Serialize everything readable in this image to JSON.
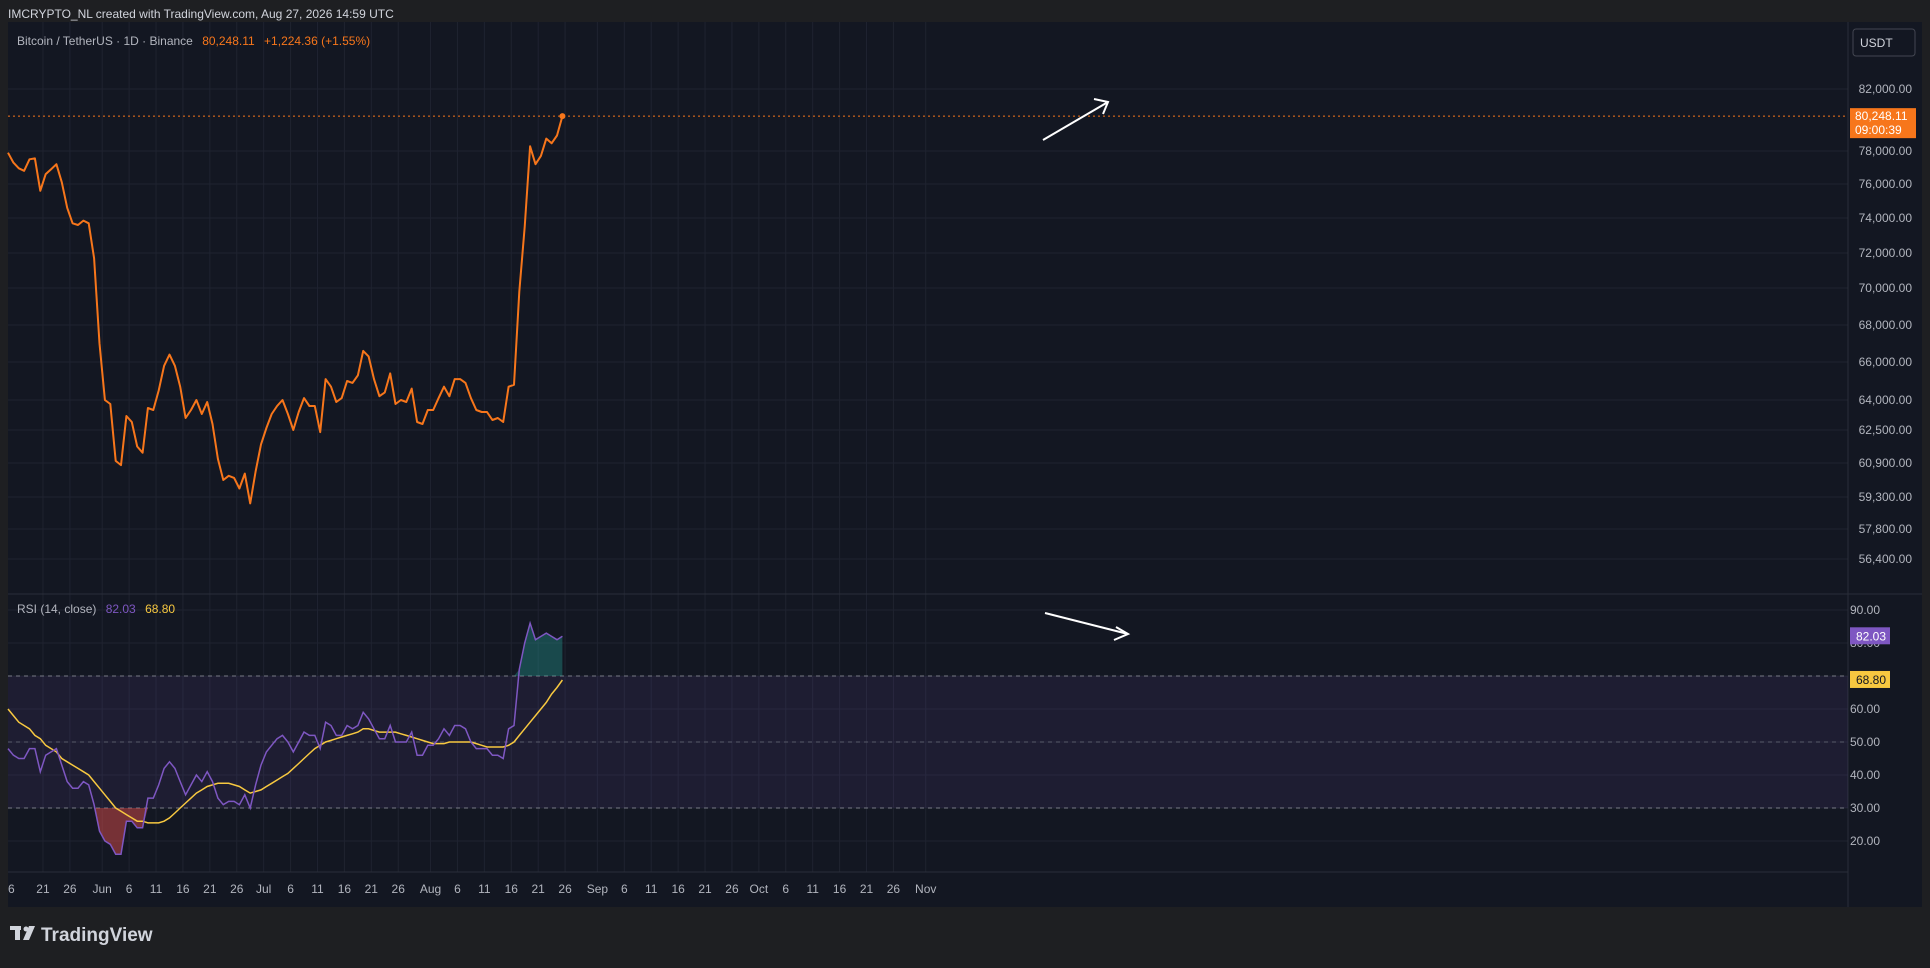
{
  "header": {
    "credit": "IMCRYPTO_NL created with TradingView.com, Aug 27, 2026 14:59 UTC"
  },
  "symbol": {
    "name": "Bitcoin / TetherUS · 1D · Binance",
    "price": "80,248.11",
    "change": "+1,224.36 (+1.55%)"
  },
  "currency_button": "USDT",
  "price_tag": {
    "value": "80,248.11",
    "countdown": "09:00:39"
  },
  "rsi_legend": {
    "label": "RSI (14, close)",
    "rsi": "82.03",
    "ma": "68.80"
  },
  "rsi_tags": {
    "rsi": "82.03",
    "ma": "68.80"
  },
  "footer": {
    "brand": "TradingView"
  },
  "colors": {
    "background": "#131722",
    "price_line": "#f7761b",
    "rsi_line": "#7e57c2",
    "rsi_ma": "#f7c840",
    "text": "#b2b5be",
    "grid": "#1f2330"
  },
  "chart_data": [
    {
      "type": "line",
      "series": [
        {
          "values": [
            77900,
            77300,
            76950,
            76800,
            77500,
            77550,
            75600,
            76600,
            76900,
            77200,
            76100,
            74600,
            73700,
            73600,
            73850,
            73700,
            71700,
            67000,
            64000,
            63800,
            61000,
            60800,
            63200,
            62900,
            61700,
            61400,
            63600,
            63500,
            64500,
            65800,
            66400,
            65800,
            64700,
            63100,
            63500,
            64000,
            63300,
            63900,
            62800,
            61100,
            60100,
            60300,
            60200,
            59700,
            60400,
            59000,
            60500,
            61800,
            62600,
            63300,
            63700,
            64000,
            63300,
            62500,
            63400,
            64100,
            63700,
            63700,
            62400,
            65100,
            64700,
            63900,
            64100,
            65000,
            64900,
            65300,
            66600,
            66300,
            65100,
            64200,
            64400,
            65400,
            63800,
            64000,
            63900,
            64600,
            62900,
            62800,
            63500,
            63500,
            64100,
            64700,
            64200,
            65100,
            65100,
            64900,
            64100,
            63500,
            63400,
            63400,
            63000,
            63100,
            62900,
            64700,
            64800,
            69800,
            73500,
            78300,
            77200,
            77700,
            78800,
            78500,
            79000,
            80248
          ]
        }
      ],
      "x_ticks": [
        "16",
        "21",
        "26",
        "Jun",
        "6",
        "11",
        "16",
        "21",
        "26",
        "Jul",
        "6",
        "11",
        "16",
        "21",
        "26",
        "Aug",
        "6",
        "11",
        "16",
        "21",
        "26",
        "Sep",
        "6",
        "11",
        "16",
        "21",
        "26",
        "Oct",
        "6",
        "11",
        "16",
        "21",
        "26",
        "Nov"
      ],
      "y_ticks": [
        "82,000.00",
        "78,000.00",
        "76,000.00",
        "74,000.00",
        "72,000.00",
        "70,000.00",
        "68,000.00",
        "66,000.00",
        "64,000.00",
        "62,500.00",
        "60,900.00",
        "59,300.00",
        "57,800.00",
        "56,400.00"
      ],
      "last_price": 80248.11
    },
    {
      "type": "line",
      "series": [
        {
          "name": "RSI (14, close)",
          "values": [
            48,
            46,
            45,
            45,
            48,
            48,
            41,
            46,
            47,
            48,
            43,
            38,
            36,
            36,
            38,
            37,
            31,
            23,
            20,
            19,
            16,
            16,
            26,
            26,
            24,
            24,
            33,
            33,
            37,
            42,
            44,
            42,
            38,
            34,
            37,
            40,
            38,
            41,
            38,
            33,
            31,
            32,
            32,
            31,
            34,
            30,
            37,
            43,
            47,
            49,
            51,
            52,
            50,
            47,
            50,
            53,
            52,
            52,
            48,
            56,
            55,
            52,
            52,
            55,
            54,
            55,
            59,
            57,
            54,
            51,
            51,
            55,
            50,
            50,
            50,
            53,
            46,
            46,
            49,
            49,
            51,
            54,
            52,
            55,
            55,
            54,
            50,
            48,
            48,
            48,
            46,
            46,
            45,
            54,
            55,
            72,
            80,
            86,
            81,
            82,
            83,
            82,
            81,
            82.03
          ]
        },
        {
          "name": "MA",
          "values": [
            60,
            58,
            56,
            55,
            54,
            52,
            51,
            49,
            48,
            47,
            45,
            44,
            43,
            42,
            41,
            40,
            38,
            36,
            34,
            32,
            30,
            29,
            28,
            27,
            26,
            26,
            25.5,
            25.5,
            25.5,
            26,
            27,
            28.5,
            30,
            31.5,
            33,
            34.5,
            35.5,
            36.5,
            37,
            37.5,
            37.5,
            37.5,
            37,
            36.5,
            35.5,
            34.5,
            35,
            35.5,
            36.5,
            37.5,
            38.5,
            39.5,
            40.5,
            42,
            43.5,
            45,
            46.5,
            48,
            49,
            50,
            50.5,
            51,
            51.5,
            52,
            52.5,
            53,
            54,
            54,
            53.5,
            53,
            53,
            53,
            53,
            52.5,
            52,
            51.5,
            51,
            50.5,
            50,
            49.5,
            49.5,
            49.5,
            50,
            50,
            50,
            50,
            50,
            49.5,
            49,
            48.5,
            48.5,
            48.5,
            48.5,
            49,
            50,
            52,
            54,
            56,
            58,
            60,
            62,
            64.5,
            66.5,
            68.8
          ]
        }
      ],
      "y_ticks": [
        "90.00",
        "80.00",
        "70.00",
        "60.00",
        "50.00",
        "40.00",
        "30.00",
        "20.00"
      ],
      "bands": {
        "upper": 70,
        "middle": 50,
        "lower": 30
      }
    }
  ]
}
